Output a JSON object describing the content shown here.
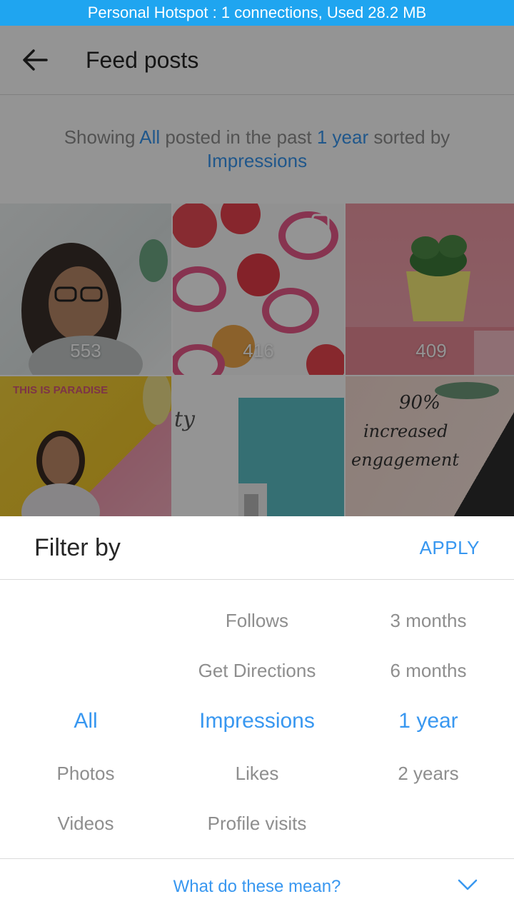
{
  "status_bar": {
    "text": "Personal Hotspot : 1 connections, Used 28.2 MB"
  },
  "toolbar": {
    "back_icon": "arrow-left-icon",
    "title": "Feed posts"
  },
  "summary": {
    "prefix": "Showing ",
    "content_type": "All",
    "middle": " posted in the past ",
    "time_range": "1 year",
    "suffix": " sorted by",
    "sort_metric": "Impressions"
  },
  "posts": [
    {
      "count": "553"
    },
    {
      "count": "416"
    },
    {
      "count": "409"
    },
    {
      "count": ""
    },
    {
      "count": ""
    },
    {
      "count": ""
    }
  ],
  "filter_sheet": {
    "title": "Filter by",
    "apply_label": "APPLY",
    "content_types": [
      "All",
      "Photos",
      "Videos"
    ],
    "metrics": [
      "Follows",
      "Get Directions",
      "Impressions",
      "Likes",
      "Profile visits"
    ],
    "time_ranges": [
      "3 months",
      "6 months",
      "1 year",
      "2 years"
    ],
    "help_label": "What do these mean?",
    "help_icon": "chevron-down-icon"
  },
  "colors": {
    "accent": "#3897f0",
    "status_bar": "#1fa5f0",
    "muted_text": "#8e8e8e"
  }
}
